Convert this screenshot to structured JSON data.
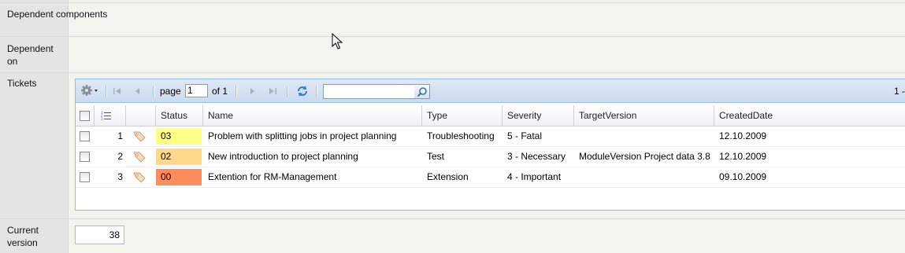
{
  "labels": {
    "dependent_components": "Dependent components",
    "dependent_on": "Dependent on",
    "tickets": "Tickets",
    "current_version": "Current version"
  },
  "toolbar": {
    "gear_icon": "gear-icon",
    "page_label": "page",
    "page_value": "1",
    "of_label": "of 1",
    "search_value": "",
    "paging_info": "1 -"
  },
  "columns": {
    "status": "Status",
    "name": "Name",
    "type": "Type",
    "severity": "Severity",
    "target_version": "TargetVersion",
    "created_date": "CreatedDate"
  },
  "rows": [
    {
      "num": "1",
      "status": "03",
      "status_color": "#ffff88",
      "name": "Problem with splitting jobs in project planning",
      "type": "Troubleshooting",
      "severity": "5 - Fatal",
      "target_version": "",
      "created": "12.10.2009"
    },
    {
      "num": "2",
      "status": "02",
      "status_color": "#ffd98a",
      "name": "New introduction to project planning",
      "type": "Test",
      "severity": "3 - Necessary",
      "target_version": "ModuleVersion Project data 3.8",
      "created": "12.10.2009"
    },
    {
      "num": "3",
      "status": "00",
      "status_color": "#ff8c5a",
      "name": "Extention for RM-Management",
      "type": "Extension",
      "severity": "4 - Important",
      "target_version": "",
      "created": "09.10.2009"
    }
  ],
  "current_version": "38"
}
